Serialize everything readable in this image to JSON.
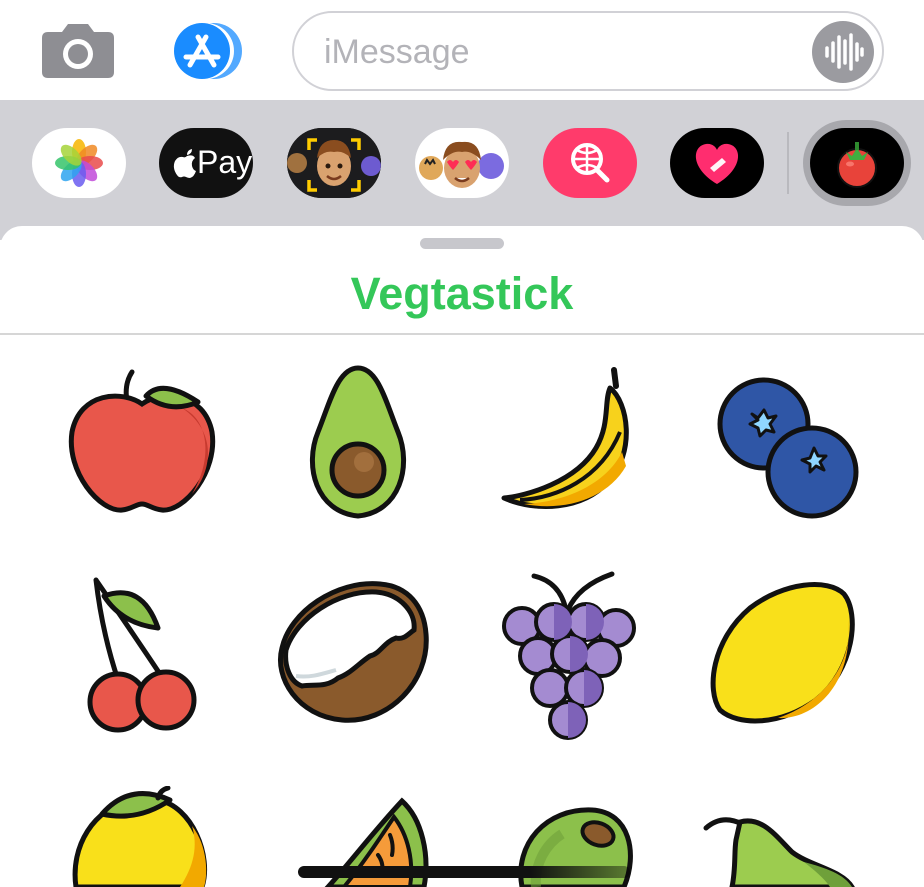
{
  "compose": {
    "placeholder": "iMessage",
    "camera_icon": "camera-icon",
    "appstore_icon": "app-store-icon",
    "audio_icon": "waveform-icon"
  },
  "drawer": {
    "apps": [
      {
        "name": "photos",
        "icon": "photos-icon"
      },
      {
        "name": "apple-pay",
        "icon": "apple-pay-icon",
        "label": "Pay"
      },
      {
        "name": "memoji",
        "icon": "memoji-icon"
      },
      {
        "name": "memoji-stickers",
        "icon": "memoji-stickers-icon"
      },
      {
        "name": "image-search",
        "icon": "globe-search-icon"
      },
      {
        "name": "digital-touch",
        "icon": "heart-touch-icon"
      },
      {
        "name": "vegtastick",
        "icon": "tomato-icon",
        "selected": true
      }
    ]
  },
  "sheet": {
    "title": "Vegtastick",
    "stickers": [
      {
        "name": "apple"
      },
      {
        "name": "avocado"
      },
      {
        "name": "banana"
      },
      {
        "name": "blueberries"
      },
      {
        "name": "cherries"
      },
      {
        "name": "coconut"
      },
      {
        "name": "grapes"
      },
      {
        "name": "lemon"
      },
      {
        "name": "mango"
      },
      {
        "name": "melon-slice"
      },
      {
        "name": "olive"
      },
      {
        "name": "pear"
      }
    ]
  },
  "colors": {
    "title_green": "#34c759",
    "appstore_blue": "#1a8cff",
    "drawer_bg": "#d1d1d6"
  }
}
